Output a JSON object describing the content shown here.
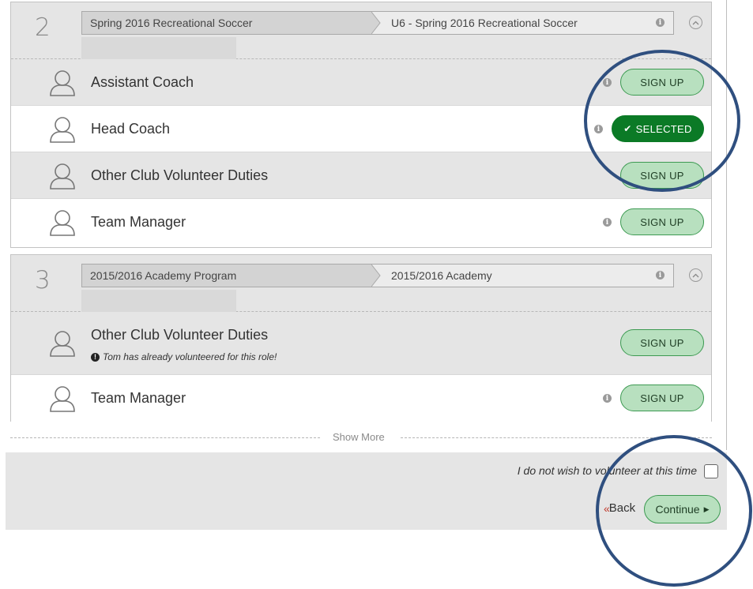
{
  "sections": [
    {
      "number": "2",
      "program": "Spring 2016 Recreational Soccer",
      "division": "U6 - Spring 2016 Recreational Soccer",
      "roles": [
        {
          "name": "Assistant Coach",
          "button": "SIGN UP",
          "selected": false,
          "info": true
        },
        {
          "name": "Head Coach",
          "button": "SELECTED",
          "selected": true,
          "info": true
        },
        {
          "name": "Other Club Volunteer Duties",
          "button": "SIGN UP",
          "selected": false,
          "info": false
        },
        {
          "name": "Team Manager",
          "button": "SIGN UP",
          "selected": false,
          "info": true
        }
      ]
    },
    {
      "number": "3",
      "program": "2015/2016 Academy Program",
      "division": "2015/2016 Academy",
      "roles": [
        {
          "name": "Other Club Volunteer Duties",
          "button": "SIGN UP",
          "selected": false,
          "info": false,
          "note": "Tom has already volunteered for this role!"
        },
        {
          "name": "Team Manager",
          "button": "SIGN UP",
          "selected": false,
          "info": true
        }
      ]
    }
  ],
  "show_more": "Show More",
  "footer": {
    "decline_label": "I do not wish to volunteer at this time",
    "back_label": "Back",
    "continue_label": "Continue"
  },
  "colors": {
    "button_fill": "#b8e0bf",
    "button_border": "#3d9a52",
    "selected_fill": "#0b7a26",
    "annotation_circle": "#2f4f7f"
  }
}
